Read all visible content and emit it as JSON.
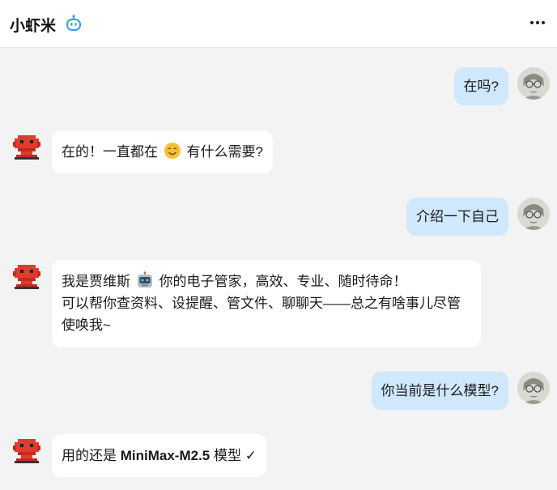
{
  "header": {
    "title": "小虾米",
    "bot_icon": "robot-icon",
    "more_icon": "more-horizontal-icon"
  },
  "colors": {
    "user_bubble": "#cfe8fc",
    "bot_bubble": "#ffffff",
    "background": "#f3f3f3",
    "accent_icon": "#3b9be8",
    "bot_avatar": "#e23a2e"
  },
  "messages": [
    {
      "role": "user",
      "text": "在吗?"
    },
    {
      "role": "bot",
      "before": "在的！一直都在",
      "emoji": "smiling-face-emoji",
      "after": "有什么需要?"
    },
    {
      "role": "user",
      "text": "介绍一下自己"
    },
    {
      "role": "bot",
      "line1_before": "我是贾维斯",
      "emoji": "robot-face-emoji",
      "line1_after": "你的电子管家，高效、专业、随时待命！",
      "line2": "可以帮你查资料、设提醒、管文件、聊聊天——总之有啥事儿尽管使唤我~"
    },
    {
      "role": "user",
      "text": "你当前是什么模型?"
    },
    {
      "role": "bot",
      "before": "用的还是",
      "model": "MiniMax-M2.5",
      "after": "模型 ✓"
    }
  ]
}
